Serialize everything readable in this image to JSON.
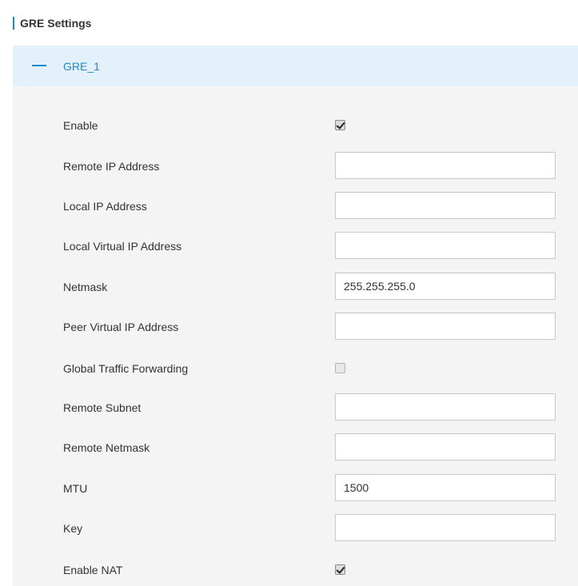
{
  "header": {
    "title": "GRE Settings",
    "accent_color": "#1a8ad6"
  },
  "panel": {
    "title": "GRE_1",
    "collapse_icon": "minus-icon"
  },
  "fields": {
    "enable": {
      "label": "Enable",
      "checked": true
    },
    "remote_ip": {
      "label": "Remote IP Address",
      "value": ""
    },
    "local_ip": {
      "label": "Local IP Address",
      "value": ""
    },
    "local_virtual_ip": {
      "label": "Local Virtual IP Address",
      "value": ""
    },
    "netmask": {
      "label": "Netmask",
      "value": "255.255.255.0"
    },
    "peer_virtual_ip": {
      "label": "Peer Virtual IP Address",
      "value": ""
    },
    "global_traffic_forwarding": {
      "label": "Global Traffic Forwarding",
      "checked": false
    },
    "remote_subnet": {
      "label": "Remote Subnet",
      "value": ""
    },
    "remote_netmask": {
      "label": "Remote Netmask",
      "value": ""
    },
    "mtu": {
      "label": "MTU",
      "value": "1500"
    },
    "key": {
      "label": "Key",
      "value": ""
    },
    "enable_nat": {
      "label": "Enable NAT",
      "checked": true
    }
  }
}
